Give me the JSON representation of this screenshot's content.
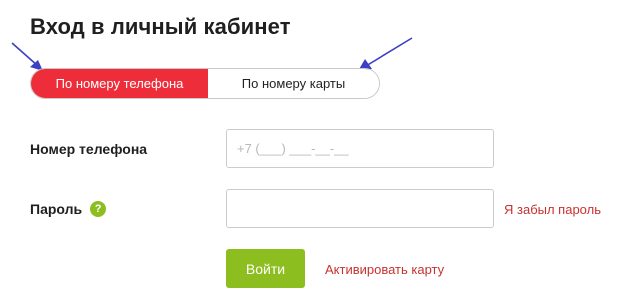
{
  "header": {
    "title": "Вход в личный кабинет"
  },
  "tabs": [
    {
      "label": "По номеру телефона",
      "active": true
    },
    {
      "label": "По номеру карты",
      "active": false
    }
  ],
  "form": {
    "phone_label": "Номер телефона",
    "phone_placeholder": "+7 (___) ___-__-__",
    "phone_value": "",
    "password_label": "Пароль",
    "password_help_icon": "?",
    "password_value": "",
    "forgot_password_link": "Я забыл пароль",
    "submit_label": "Войти",
    "activate_card_link": "Активировать карту"
  },
  "colors": {
    "active_tab": "#ee2d3b",
    "submit_button": "#8dbe1f",
    "help_icon": "#8dbe1f",
    "link": "#c7322f",
    "annotation_arrow": "#3b3fc4"
  },
  "icons": {
    "annotation_arrows": "arrow-icon",
    "help": "question-circle-icon"
  }
}
